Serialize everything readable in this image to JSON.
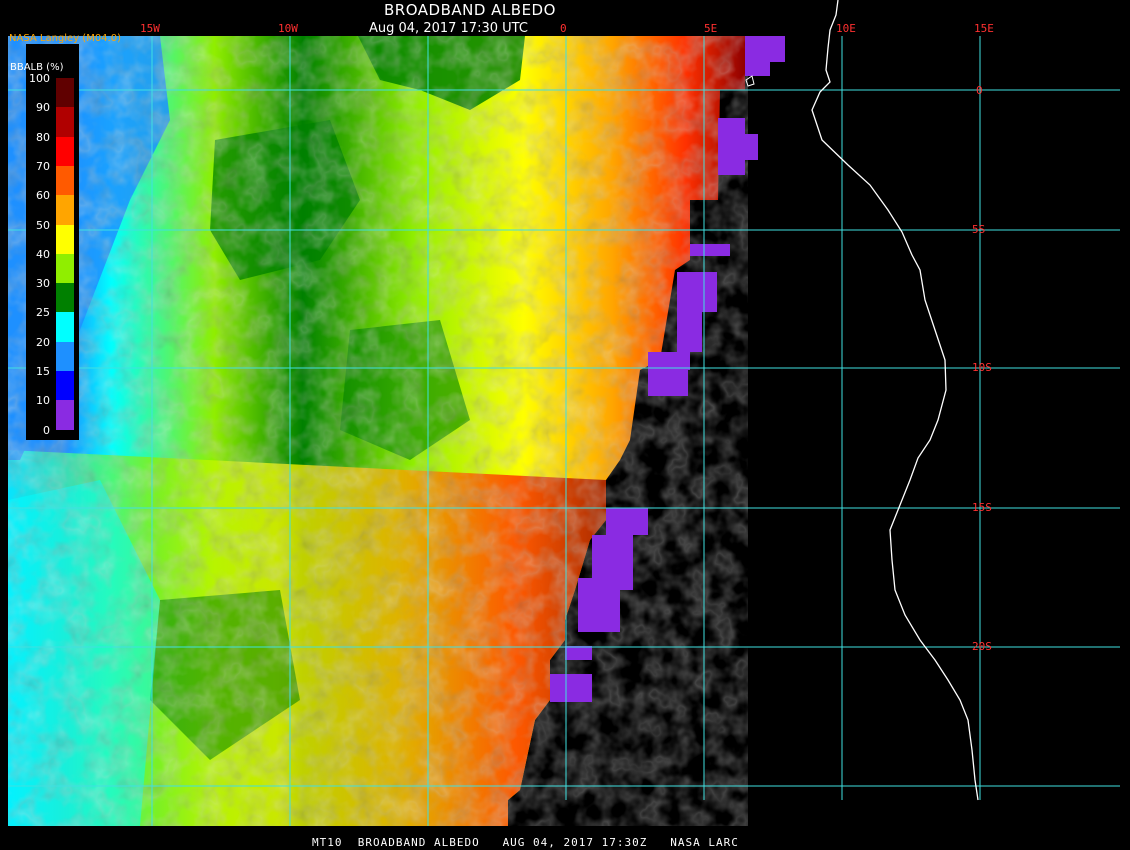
{
  "header": {
    "title": "BROADBAND ALBEDO",
    "subtitle": "Aug 04, 2017 17:30 UTC",
    "org": "NASA Langley (M04.0)"
  },
  "footer": {
    "text": "MT10  BROADBAND ALBEDO   AUG 04, 2017 17:30Z   NASA LARC"
  },
  "legend": {
    "title": "BBALB (%)",
    "ticks": [
      "100",
      "90",
      "80",
      "70",
      "60",
      "50",
      "40",
      "30",
      "25",
      "20",
      "15",
      "10",
      "0"
    ],
    "colors": [
      "#600000",
      "#b00000",
      "#ff0000",
      "#ff5a00",
      "#ffa500",
      "#ffff00",
      "#90ee00",
      "#008000",
      "#00ffff",
      "#1e90ff",
      "#0000ff",
      "#8a2be2"
    ]
  },
  "map": {
    "lon_labels": [
      "15W",
      "10W",
      "0",
      "5E",
      "10E",
      "15E"
    ],
    "lat_labels": [
      "0",
      "5S",
      "10S",
      "15S",
      "20S"
    ]
  }
}
